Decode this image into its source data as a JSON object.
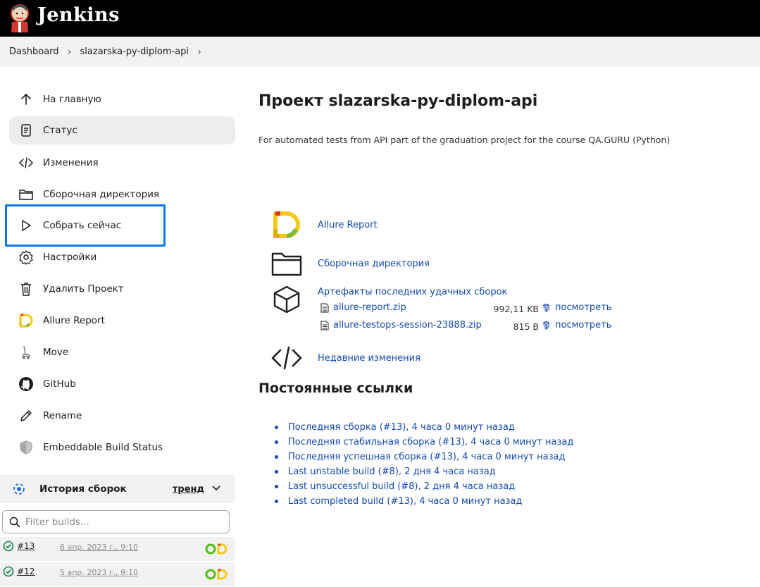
{
  "header": {
    "brand": "Jenkins"
  },
  "breadcrumb": {
    "items": [
      "Dashboard",
      "slazarska-py-diplom-api"
    ]
  },
  "sidebar": {
    "items": [
      {
        "label": "На главную",
        "icon": "arrow-up-icon"
      },
      {
        "label": "Статус",
        "icon": "document-icon"
      },
      {
        "label": "Изменения",
        "icon": "code-icon"
      },
      {
        "label": "Сборочная директория",
        "icon": "folder-icon"
      },
      {
        "label": "Собрать сейчас",
        "icon": "play-icon"
      },
      {
        "label": "Настройки",
        "icon": "gear-icon"
      },
      {
        "label": "Удалить Проект",
        "icon": "trash-icon"
      },
      {
        "label": "Allure Report",
        "icon": "allure-icon"
      },
      {
        "label": "Move",
        "icon": "move-icon"
      },
      {
        "label": "GitHub",
        "icon": "github-icon"
      },
      {
        "label": "Rename",
        "icon": "pencil-icon"
      },
      {
        "label": "Embeddable Build Status",
        "icon": "shield-icon"
      }
    ],
    "active_index": 1,
    "highlight_color": "#0a76e8"
  },
  "history": {
    "title": "История сборок",
    "trend": "тренд",
    "filter_placeholder": "Filter builds...",
    "builds": [
      {
        "number": "#13",
        "date": "6 апр. 2023 г., 9:10"
      },
      {
        "number": "#12",
        "date": "5 апр. 2023 г., 9:10"
      }
    ]
  },
  "main": {
    "title": "Проект slazarska-py-diplom-api",
    "description": "For automated tests from API part of the graduation project for the course QA.GURU (Python)",
    "allure_link": "Allure Report",
    "workspace_link": "Сборочная директория",
    "artifacts": {
      "title": "Артефакты последних удачных сборок",
      "files": [
        {
          "name": "allure-report.zip",
          "size": "992,11 KB",
          "view": "посмотреть"
        },
        {
          "name": "allure-testops-session-23888.zip",
          "size": "815 B",
          "view": "посмотреть"
        }
      ]
    },
    "changes_link": "Недавние изменения",
    "permalinks_title": "Постоянные ссылки",
    "permalinks": [
      "Последняя сборка (#13), 4 часа 0 минут назад",
      "Последняя стабильная сборка (#13), 4 часа 0 минут назад",
      "Последняя успешная сборка (#13), 4 часа 0 минут назад",
      "Last unstable build (#8), 2 дня 4 часа назад",
      "Last unsuccessful build (#8), 2 дня 4 часа назад",
      "Last completed build (#13), 4 часа 0 минут назад"
    ],
    "link_color": "#1449b0"
  }
}
